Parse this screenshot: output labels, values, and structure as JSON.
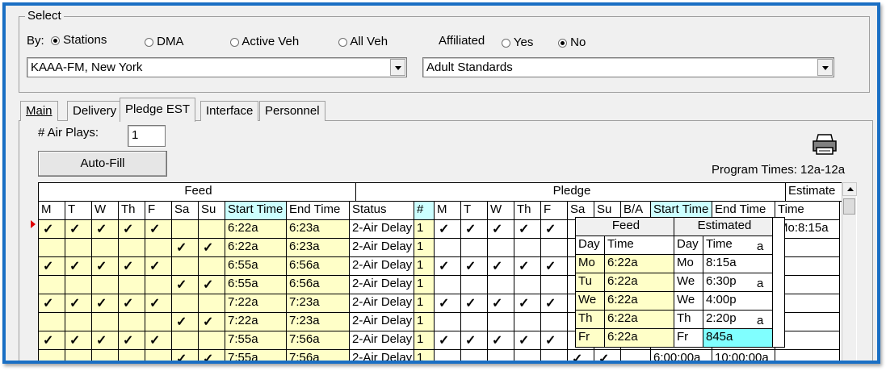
{
  "select": {
    "legend": "Select",
    "by_label": "By:",
    "radios": [
      {
        "label": "Stations",
        "selected": true
      },
      {
        "label": "DMA",
        "selected": false
      },
      {
        "label": "Active Veh",
        "selected": false
      },
      {
        "label": "All Veh",
        "selected": false
      }
    ],
    "affiliated_label": "Affiliated",
    "affiliated": [
      {
        "label": "Yes",
        "selected": false
      },
      {
        "label": "No",
        "selected": true
      }
    ],
    "station_value": "KAAA-FM, New York",
    "format_value": "Adult Standards"
  },
  "tabs": [
    "Main",
    "Delivery",
    "Pledge EST",
    "Interface",
    "Personnel"
  ],
  "active_tab": "Pledge EST",
  "air_plays_label": "# Air Plays:",
  "air_plays_value": "1",
  "autofill_label": "Auto-Fill",
  "program_times": "Program Times: 12a-12a",
  "grid": {
    "group_feed": "Feed",
    "group_pledge": "Pledge",
    "group_estimate": "Estimate",
    "headers": [
      "M",
      "T",
      "W",
      "Th",
      "F",
      "Sa",
      "Su",
      "Start Time",
      "End Time",
      "Status",
      "#",
      "M",
      "T",
      "W",
      "Th",
      "F",
      "Sa",
      "Su",
      "B/A",
      "Start Time",
      "End Time",
      "Time"
    ],
    "rows": [
      {
        "feed": [
          "✓",
          "✓",
          "✓",
          "✓",
          "✓",
          "",
          ""
        ],
        "start": "6:22a",
        "end": "6:23a",
        "status": "2-Air Delay",
        "num": "1",
        "pledge": [
          "✓",
          "✓",
          "✓",
          "✓",
          "✓"
        ],
        "est": "Mo:8:15a",
        "current": true
      },
      {
        "feed": [
          "",
          "",
          "",
          "",
          "",
          "✓",
          "✓"
        ],
        "start": "6:22a",
        "end": "6:23a",
        "status": "2-Air Delay",
        "num": "1",
        "pledge": [
          "",
          "",
          "",
          "",
          ""
        ],
        "est": ""
      },
      {
        "feed": [
          "✓",
          "✓",
          "✓",
          "✓",
          "✓",
          "",
          ""
        ],
        "start": "6:55a",
        "end": "6:56a",
        "status": "2-Air Delay",
        "num": "1",
        "pledge": [
          "✓",
          "✓",
          "✓",
          "✓",
          "✓"
        ],
        "est": ""
      },
      {
        "feed": [
          "",
          "",
          "",
          "",
          "",
          "✓",
          "✓"
        ],
        "start": "6:55a",
        "end": "6:56a",
        "status": "2-Air Delay",
        "num": "1",
        "pledge": [
          "",
          "",
          "",
          "",
          ""
        ],
        "est": ""
      },
      {
        "feed": [
          "✓",
          "✓",
          "✓",
          "✓",
          "✓",
          "",
          ""
        ],
        "start": "7:22a",
        "end": "7:23a",
        "status": "2-Air Delay",
        "num": "1",
        "pledge": [
          "✓",
          "✓",
          "✓",
          "✓",
          "✓"
        ],
        "est": ""
      },
      {
        "feed": [
          "",
          "",
          "",
          "",
          "",
          "✓",
          "✓"
        ],
        "start": "7:22a",
        "end": "7:23a",
        "status": "2-Air Delay",
        "num": "1",
        "pledge": [
          "",
          "",
          "",
          "",
          ""
        ],
        "est": ""
      },
      {
        "feed": [
          "✓",
          "✓",
          "✓",
          "✓",
          "✓",
          "",
          ""
        ],
        "start": "7:55a",
        "end": "7:56a",
        "status": "2-Air Delay",
        "num": "1",
        "pledge": [
          "✓",
          "✓",
          "✓",
          "✓",
          "✓"
        ],
        "est": ""
      },
      {
        "feed": [
          "",
          "",
          "",
          "",
          "",
          "✓",
          "✓"
        ],
        "start": "7:55a",
        "end": "7:56a",
        "status": "2-Air Delay",
        "num": "1",
        "pledge": [
          "",
          "",
          "",
          "",
          ""
        ],
        "est": ""
      }
    ],
    "partial_right": {
      "sa": "✓",
      "su": "✓",
      "start": "6:00:00a",
      "end": "10:00:00a"
    },
    "edge_a": [
      "a",
      "a",
      "a",
      "a"
    ]
  },
  "popup": {
    "feed_title": "Feed",
    "est_title": "Estimated",
    "cols": [
      "Day",
      "Time",
      "Day",
      "Time"
    ],
    "rows": [
      {
        "fday": "Mo",
        "ftime": "6:22a",
        "eday": "Mo",
        "etime": "8:15a"
      },
      {
        "fday": "Tu",
        "ftime": "6:22a",
        "eday": "We",
        "etime": "6:30p"
      },
      {
        "fday": "We",
        "ftime": "6:22a",
        "eday": "We",
        "etime": "4:00p"
      },
      {
        "fday": "Th",
        "ftime": "6:22a",
        "eday": "Th",
        "etime": "2:20p"
      },
      {
        "fday": "Fr",
        "ftime": "6:22a",
        "eday": "Fr",
        "etime": "845a",
        "editing": true
      }
    ]
  },
  "colors": {
    "frame": "#1a6fc4",
    "highlight": "#ccffff",
    "yellow": "#ffffc8",
    "marker": "#e00000"
  }
}
